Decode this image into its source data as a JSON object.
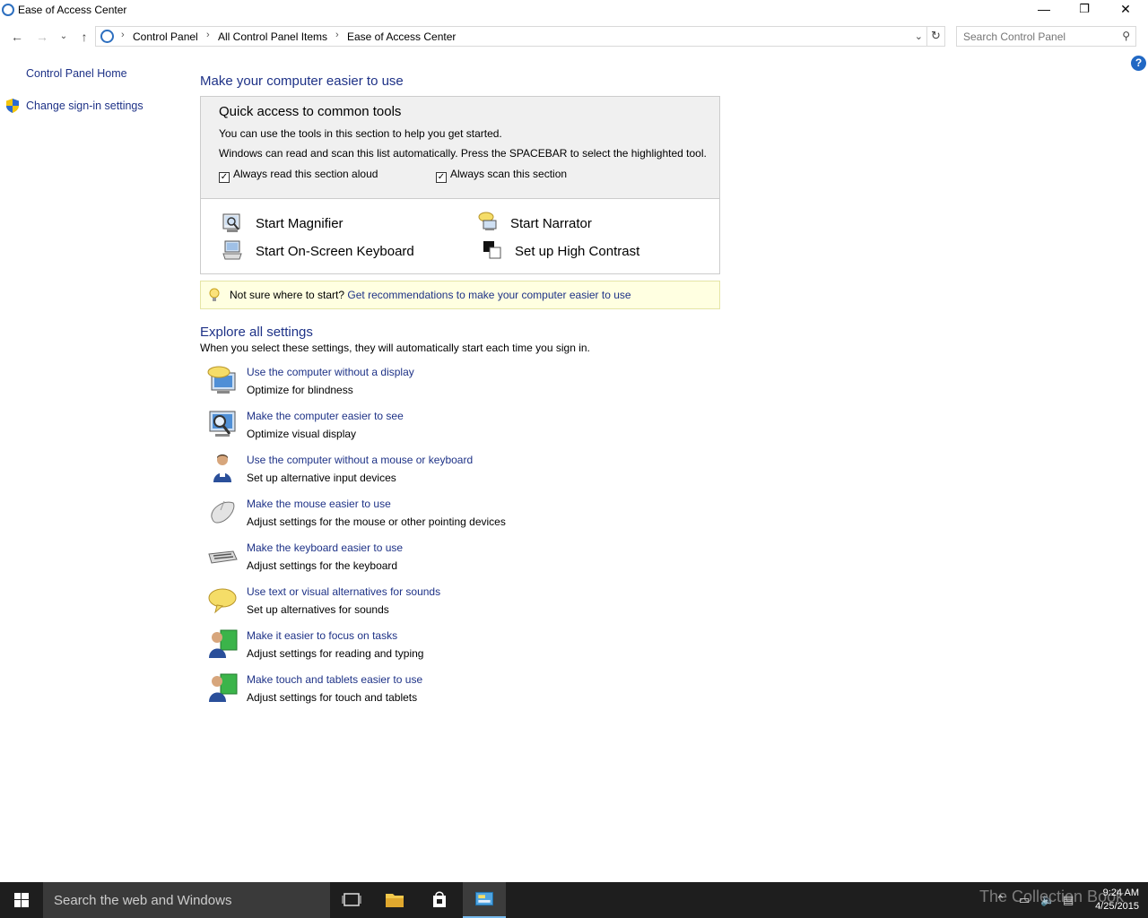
{
  "window": {
    "title": "Ease of Access Center",
    "controls": {
      "minimize": "—",
      "maximize": "❐",
      "close": "✕"
    }
  },
  "addressbar": {
    "breadcrumbs": [
      "Control Panel",
      "All Control Panel Items",
      "Ease of Access Center"
    ],
    "search_placeholder": "Search Control Panel"
  },
  "leftpane": {
    "home": "Control Panel Home",
    "signin": "Change sign-in settings"
  },
  "main": {
    "title": "Make your computer easier to use",
    "quick_access": {
      "heading": "Quick access to common tools",
      "line1": "You can use the tools in this section to help you get started.",
      "line2": "Windows can read and scan this list automatically.  Press the SPACEBAR to select the highlighted tool.",
      "chk_read": "Always read this section aloud",
      "chk_scan": "Always scan this section",
      "tools": {
        "magnifier": "Start Magnifier",
        "narrator": "Start Narrator",
        "osk": "Start On-Screen Keyboard",
        "contrast": "Set up High Contrast"
      }
    },
    "tip": {
      "prefix": "Not sure where to start?",
      "link": "Get recommendations to make your computer easier to use"
    },
    "explore": {
      "title": "Explore all settings",
      "subtitle": "When you select these settings, they will automatically start each time you sign in.",
      "items": [
        {
          "link": "Use the computer without a display",
          "desc": "Optimize for blindness"
        },
        {
          "link": "Make the computer easier to see",
          "desc": "Optimize visual display"
        },
        {
          "link": "Use the computer without a mouse or keyboard",
          "desc": "Set up alternative input devices"
        },
        {
          "link": "Make the mouse easier to use",
          "desc": "Adjust settings for the mouse or other pointing devices"
        },
        {
          "link": "Make the keyboard easier to use",
          "desc": "Adjust settings for the keyboard"
        },
        {
          "link": "Use text or visual alternatives for sounds",
          "desc": "Set up alternatives for sounds"
        },
        {
          "link": "Make it easier to focus on tasks",
          "desc": "Adjust settings for reading and typing"
        },
        {
          "link": "Make touch and tablets easier to use",
          "desc": "Adjust settings for touch and tablets"
        }
      ]
    }
  },
  "taskbar": {
    "search_text": "Search the web and Windows",
    "time": "9:24 AM",
    "date": "4/25/2015",
    "watermark": "The Collection Book"
  },
  "colors": {
    "link": "#1e3287",
    "accent": "#2168c4",
    "taskbar": "#1e1e1e"
  }
}
